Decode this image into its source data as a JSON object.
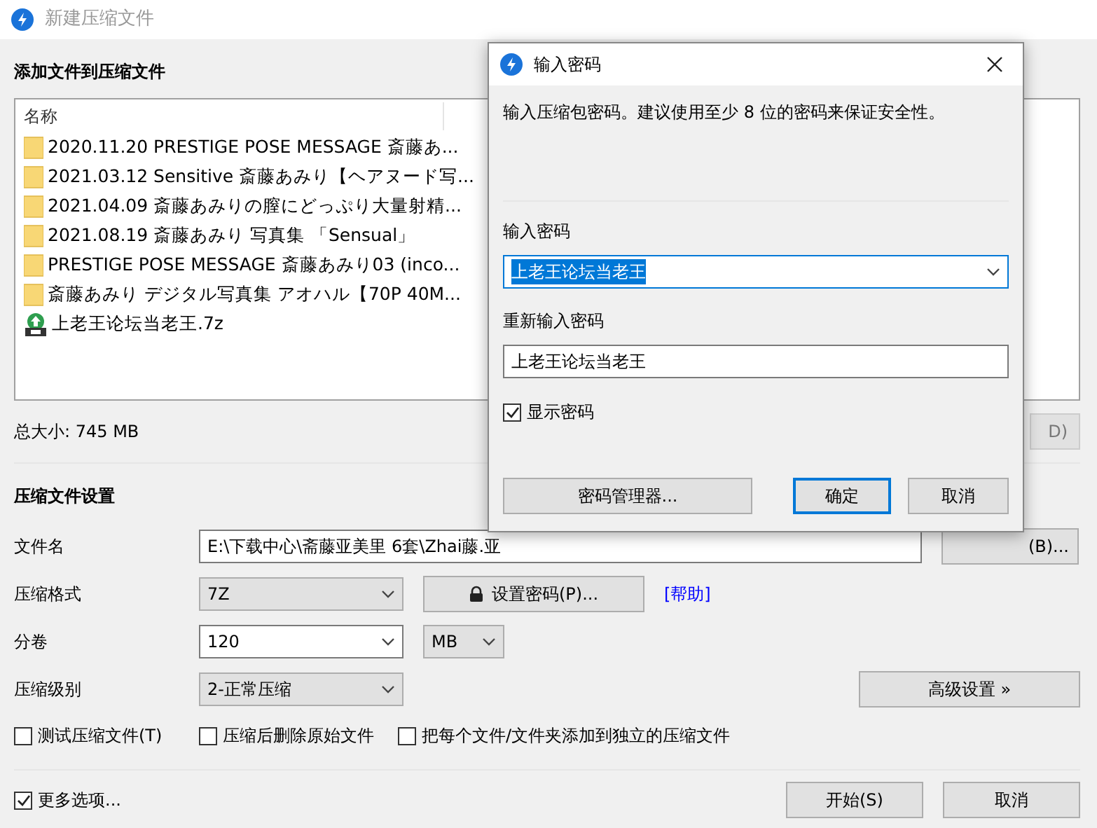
{
  "main_window": {
    "title": "新建压缩文件",
    "files_heading": "添加文件到压缩文件",
    "file_list": {
      "columns": [
        "名称"
      ],
      "items": [
        {
          "kind": "folder",
          "name": "2020.11.20 PRESTIGE POSE MESSAGE 斎藤あ..."
        },
        {
          "kind": "folder",
          "name": "2021.03.12 Sensitive 斎藤あみり【ヘアヌード写..."
        },
        {
          "kind": "folder",
          "name": "2021.04.09 斎藤あみりの膣にどっぷり大量射精..."
        },
        {
          "kind": "folder",
          "name": "2021.08.19 斎藤あみり 写真集 「Sensual」"
        },
        {
          "kind": "folder",
          "name": "PRESTIGE POSE MESSAGE 斎藤あみり03 (inco..."
        },
        {
          "kind": "folder",
          "name": "斎藤あみり デジタル写真集 アオハル【70P 40M..."
        },
        {
          "kind": "archive",
          "name": "上老王论坛当老王.7z"
        }
      ]
    },
    "total_size": "总大小: 745 MB",
    "side_button": "D)",
    "settings_heading": "压缩文件设置",
    "filename": {
      "label": "文件名",
      "value": "E:\\下载中心\\斋藤亚美里 6套\\Zhai藤.亚",
      "browse_button": "(B)..."
    },
    "format": {
      "label": "压缩格式",
      "value": "7Z"
    },
    "password_button": "设置密码(P)...",
    "help_link": "[帮助]",
    "split": {
      "label": "分卷",
      "value": "120",
      "unit": "MB"
    },
    "level": {
      "label": "压缩级别",
      "value": "2-正常压缩"
    },
    "advanced_button": "高级设置 »",
    "options": [
      {
        "label": "测试压缩文件(T)",
        "checked": false
      },
      {
        "label": "压缩后删除原始文件",
        "checked": false
      },
      {
        "label": "把每个文件/文件夹添加到独立的压缩文件",
        "checked": false
      }
    ],
    "more_options": {
      "label": "更多选项...",
      "checked": true
    },
    "buttons": [
      "开始(S)",
      "取消"
    ]
  },
  "password_dialog": {
    "title": "输入密码",
    "message": "输入压缩包密码。建议使用至少 8 位的密码来保证安全性。",
    "password_label": "输入密码",
    "password_value": "上老王论坛当老王",
    "password_text_selected": true,
    "confirm_label": "重新输入密码",
    "confirm_value": "上老王论坛当老王",
    "show_password": {
      "label": "显示密码",
      "checked": true
    },
    "manager_button": "密码管理器...",
    "buttons": [
      {
        "label": "确定",
        "default": true
      },
      {
        "label": "取消",
        "default": false
      }
    ]
  }
}
